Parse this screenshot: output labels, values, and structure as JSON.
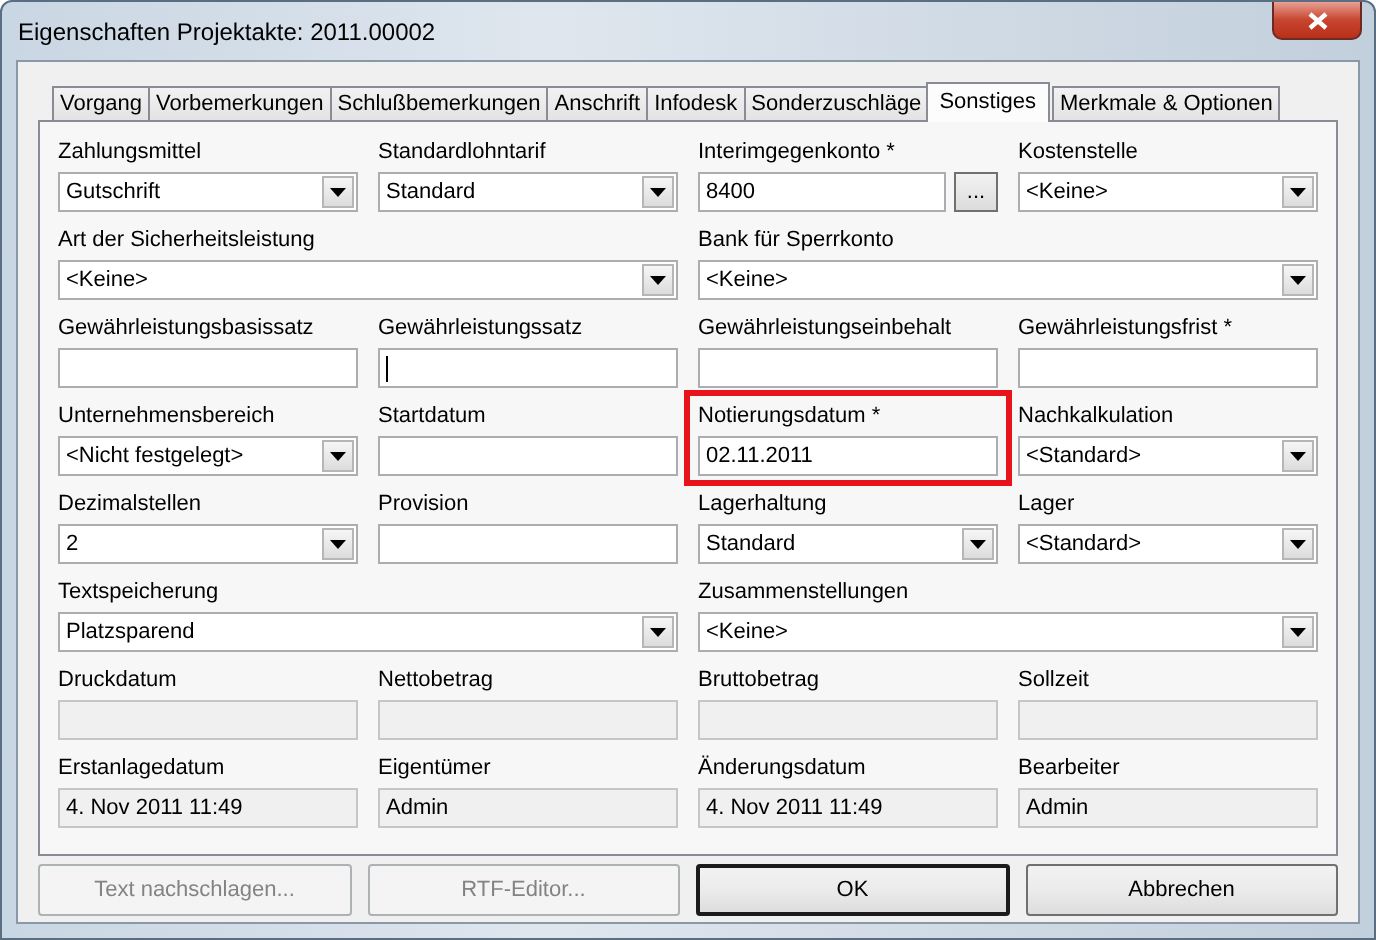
{
  "window": {
    "title": "Eigenschaften Projektakte: 2011.00002"
  },
  "tabs": [
    {
      "label": "Vorgang",
      "selected": false
    },
    {
      "label": "Vorbemerkungen",
      "selected": false
    },
    {
      "label": "Schlußbemerkungen",
      "selected": false
    },
    {
      "label": "Anschrift",
      "selected": false
    },
    {
      "label": "Infodesk",
      "selected": false
    },
    {
      "label": "Sonderzuschläge",
      "selected": false
    },
    {
      "label": "Sonstiges",
      "selected": true
    },
    {
      "label": "Merkmale & Optionen",
      "selected": false
    }
  ],
  "fields": [
    {
      "label": "Zahlungsmittel",
      "kind": "dropdown",
      "value": "Gutschrift"
    },
    {
      "label": "Standardlohntarif",
      "kind": "dropdown",
      "value": "Standard"
    },
    {
      "label": "Interimgegenkonto *",
      "kind": "browse",
      "value": "8400",
      "button": "..."
    },
    {
      "label": "Kostenstelle",
      "kind": "dropdown",
      "value": "<Keine>"
    },
    {
      "label": "Art der Sicherheitsleistung",
      "kind": "dropdown",
      "value": "<Keine>",
      "wide": true
    },
    {
      "label": "Bank für Sperrkonto",
      "kind": "dropdown",
      "value": "<Keine>",
      "wide": true
    },
    {
      "label": "Gewährleistungsbasissatz",
      "kind": "text"
    },
    {
      "label": "Gewährleistungssatz",
      "kind": "text",
      "focused": true
    },
    {
      "label": "Gewährleistungseinbehalt",
      "kind": "text"
    },
    {
      "label": "Gewährleistungsfrist *",
      "kind": "text"
    },
    {
      "label": "Unternehmensbereich",
      "kind": "dropdown",
      "value": "<Nicht festgelegt>"
    },
    {
      "label": "Startdatum",
      "kind": "text"
    },
    {
      "label": "Notierungsdatum *",
      "kind": "text",
      "value": "02.11.2011",
      "highlighted": true
    },
    {
      "label": "Nachkalkulation",
      "kind": "dropdown",
      "value": "<Standard>"
    },
    {
      "label": "Dezimalstellen",
      "kind": "dropdown",
      "value": "2"
    },
    {
      "label": "Provision",
      "kind": "text"
    },
    {
      "label": "Lagerhaltung",
      "kind": "dropdown",
      "value": "Standard"
    },
    {
      "label": "Lager",
      "kind": "dropdown",
      "value": "<Standard>"
    },
    {
      "label": "Textspeicherung",
      "kind": "dropdown",
      "value": "Platzsparend",
      "wide": true
    },
    {
      "label": "Zusammenstellungen",
      "kind": "dropdown",
      "value": "<Keine>",
      "wide": true
    },
    {
      "label": "Druckdatum",
      "kind": "readonly"
    },
    {
      "label": "Nettobetrag",
      "kind": "readonly"
    },
    {
      "label": "Bruttobetrag",
      "kind": "readonly"
    },
    {
      "label": "Sollzeit",
      "kind": "readonly"
    },
    {
      "label": "Erstanlagedatum",
      "kind": "readonly",
      "value": "4. Nov 2011 11:49"
    },
    {
      "label": "Eigentümer",
      "kind": "readonly",
      "value": "Admin"
    },
    {
      "label": "Änderungsdatum",
      "kind": "readonly",
      "value": "4. Nov 2011 11:49"
    },
    {
      "label": "Bearbeiter",
      "kind": "readonly",
      "value": "Admin"
    }
  ],
  "buttons": [
    {
      "label": "Text nachschlagen...",
      "disabled": true,
      "default": false
    },
    {
      "label": "RTF-Editor...",
      "disabled": true,
      "default": false
    },
    {
      "label": "OK",
      "disabled": false,
      "default": true
    },
    {
      "label": "Abbrechen",
      "disabled": false,
      "default": false
    }
  ]
}
